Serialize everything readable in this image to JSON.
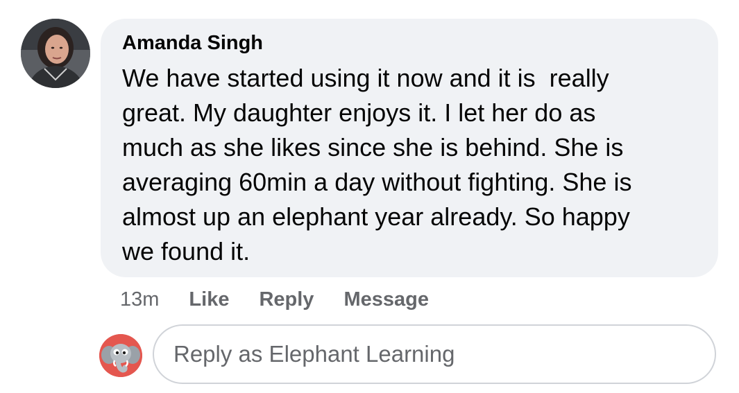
{
  "comment": {
    "author": "Amanda Singh",
    "text_lines": [
      "We have started using it now and it is  really",
      "great. My daughter enjoys it. I let her do as",
      "much as she likes since she is behind. She is",
      "averaging 60min a day without fighting. She is",
      "almost up an elephant year already. So happy",
      "we found it."
    ],
    "avatar_icon": "user-profile-photo",
    "bubble_color": "#f0f2f5"
  },
  "actions": {
    "timestamp": "13m",
    "like_label": "Like",
    "reply_label": "Reply",
    "message_label": "Message",
    "color": "#65676b"
  },
  "reply": {
    "placeholder": "Reply as Elephant Learning",
    "page_avatar_icon": "elephant-logo-icon"
  }
}
